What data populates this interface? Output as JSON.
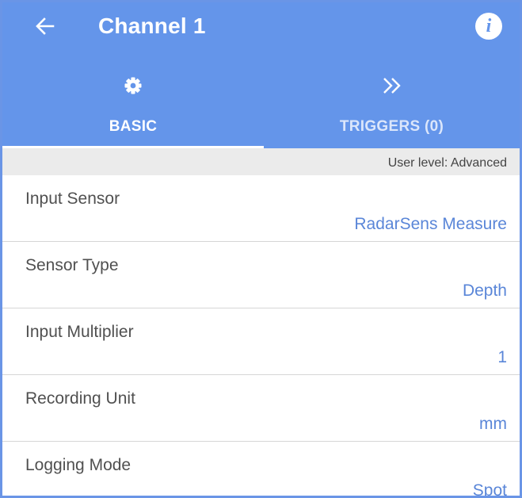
{
  "header": {
    "title": "Channel 1",
    "back_icon": "back-arrow-icon",
    "info_label": "i",
    "color": "#6495ea"
  },
  "tabs": [
    {
      "label": "BASIC",
      "icon": "gear-icon",
      "selected": true
    },
    {
      "label": "TRIGGERS (0)",
      "icon": "double-chevron-right-icon",
      "selected": false
    }
  ],
  "user_level": "User level: Advanced",
  "settings": [
    {
      "label": "Input Sensor",
      "value": "RadarSens Measure"
    },
    {
      "label": "Sensor Type",
      "value": "Depth"
    },
    {
      "label": "Input Multiplier",
      "value": "1"
    },
    {
      "label": "Recording Unit",
      "value": "mm"
    },
    {
      "label": "Logging Mode",
      "value": "Spot"
    }
  ],
  "colors": {
    "accent": "#6495ea",
    "value_text": "#5a86d8",
    "bar": "#ebebeb"
  }
}
